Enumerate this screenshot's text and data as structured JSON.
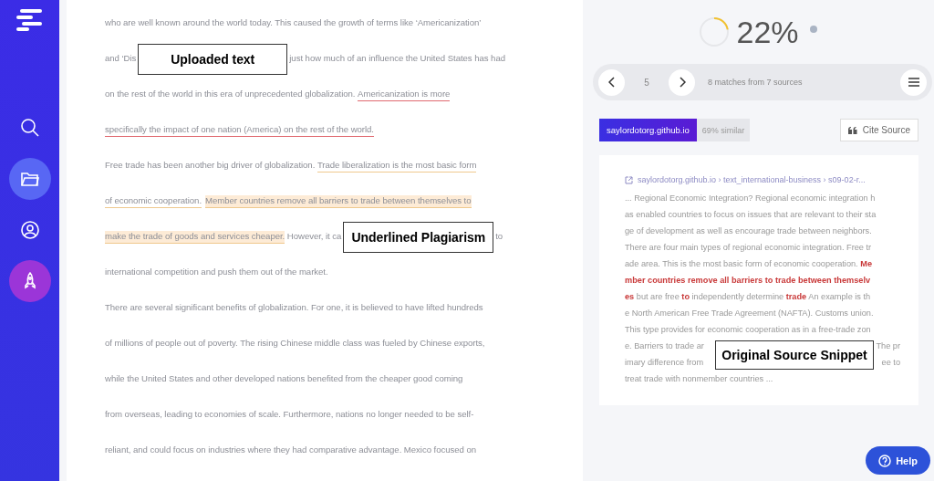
{
  "sidebar": {
    "items": [
      {
        "kind": "search",
        "selected": false
      },
      {
        "kind": "folder",
        "selected": true
      },
      {
        "kind": "user",
        "selected": false
      }
    ]
  },
  "document": {
    "lines": [
      {
        "segments": [
          {
            "kind": "text",
            "text": "who are well known around the world today. This caused the growth of terms like ‘Americanization’"
          }
        ]
      },
      {
        "segments": [
          {
            "kind": "text",
            "text": "and ‘Dis"
          },
          {
            "kind": "callout",
            "text": "Uploaded text"
          },
          {
            "kind": "text",
            "text": "just how much of an influence the United States has had"
          }
        ]
      },
      {
        "segments": [
          {
            "kind": "text",
            "text": "on the rest of the world in this era of unprecedented globalization. "
          },
          {
            "kind": "red",
            "text": "Americanization is more"
          }
        ]
      },
      {
        "segments": [
          {
            "kind": "red",
            "text": "specifically the impact of one nation (America) on the rest of the world."
          }
        ]
      },
      {
        "segments": [
          {
            "kind": "text",
            "text": "Free trade has been another big driver of globalization. "
          },
          {
            "kind": "orange",
            "text": "Trade liberalization is the most basic form"
          }
        ]
      },
      {
        "segments": [
          {
            "kind": "orange",
            "text": "of economic cooperation."
          },
          {
            "kind": "highlight",
            "text": "Member countries remove all barriers to trade between themselves to"
          }
        ]
      },
      {
        "segments": [
          {
            "kind": "highlight",
            "text": "make the trade of goods and services cheaper."
          },
          {
            "kind": "text",
            "text": " However, it ca"
          },
          {
            "kind": "callout",
            "text": "Underlined Plagiarism"
          },
          {
            "kind": "text",
            "text": "to"
          }
        ]
      },
      {
        "segments": [
          {
            "kind": "text",
            "text": "international competition and push them out of the market."
          }
        ]
      },
      {
        "segments": [
          {
            "kind": "text",
            "text": "There are several significant benefits of globalization. For one, it is believed to have lifted hundreds"
          }
        ]
      },
      {
        "segments": [
          {
            "kind": "text",
            "text": "of millions of people out of poverty. The rising Chinese middle class was fueled by Chinese exports,"
          }
        ]
      },
      {
        "segments": [
          {
            "kind": "text",
            "text": "while the United States and other developed nations benefited from the cheaper good coming"
          }
        ]
      },
      {
        "segments": [
          {
            "kind": "text",
            "text": "from overseas, leading to economies of scale. Furthermore, nations no longer needed to be self-"
          }
        ]
      },
      {
        "segments": [
          {
            "kind": "text",
            "text": "reliant, and could focus on industries where they had comparative advantage. Mexico focused on"
          }
        ]
      }
    ]
  },
  "score": {
    "percent": "22%"
  },
  "navigation": {
    "current": "5",
    "summary": "8 matches from 7 sources"
  },
  "source": {
    "domain": "saylordotorg.github.io",
    "similarity": "69% similar",
    "cite_button": "Cite Source"
  },
  "snippet": {
    "breadcrumb": "saylordotorg.github.io › text_international-business › s09-02-r...",
    "callout": "Original Source Snippet",
    "lines": [
      {
        "left": [
          {
            "kind": "text",
            "text": "... Regional Economic Integration? Regional economic integration h"
          }
        ]
      },
      {
        "left": [
          {
            "kind": "text",
            "text": "as enabled countries to focus on issues that are relevant to their sta"
          }
        ]
      },
      {
        "left": [
          {
            "kind": "text",
            "text": "ge of development as well as encourage trade between neighbors."
          }
        ]
      },
      {
        "left": [
          {
            "kind": "text",
            "text": "There are four main types of regional economic integration. Free tr"
          }
        ]
      },
      {
        "left": [
          {
            "kind": "text",
            "text": "ade area. This is the most basic form of economic cooperation. "
          },
          {
            "kind": "match",
            "text": "Me"
          }
        ]
      },
      {
        "left": [
          {
            "kind": "match",
            "text": "mber countries remove all barriers to trade between themselv"
          }
        ]
      },
      {
        "left": [
          {
            "kind": "match",
            "text": "es"
          },
          {
            "kind": "text",
            "text": " but are free "
          },
          {
            "kind": "match",
            "text": "to"
          },
          {
            "kind": "text",
            "text": " independently determine "
          },
          {
            "kind": "match",
            "text": "trade"
          },
          {
            "kind": "text",
            "text": " An example is th"
          }
        ]
      },
      {
        "left": [
          {
            "kind": "text",
            "text": "e North American Free Trade Agreement (NAFTA). Customs union."
          }
        ]
      },
      {
        "left": [
          {
            "kind": "text",
            "text": "This type provides for economic cooperation as in a free-trade zon"
          }
        ]
      },
      {
        "left": [
          {
            "kind": "text",
            "text": "e. Barriers to trade ar"
          }
        ],
        "right": [
          {
            "kind": "text",
            "text": "The pr"
          }
        ]
      },
      {
        "left": [
          {
            "kind": "text",
            "text": "imary difference from"
          }
        ],
        "right": [
          {
            "kind": "text",
            "text": "ee to"
          }
        ]
      },
      {
        "left": [
          {
            "kind": "text",
            "text": "treat trade with nonmember countries ..."
          }
        ]
      }
    ]
  },
  "help": {
    "label": "Help"
  }
}
